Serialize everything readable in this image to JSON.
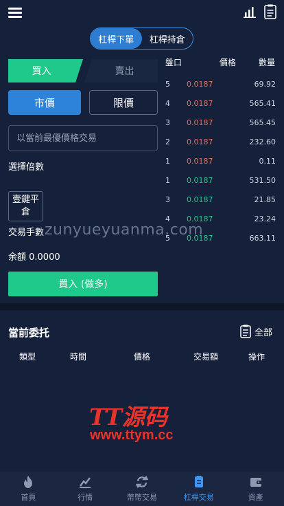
{
  "header": {
    "menu_icon": "hamburger-menu-icon",
    "chart_icon": "bar-chart-icon",
    "doc_icon": "document-list-icon"
  },
  "mode_tabs": [
    {
      "label": "杠桿下單",
      "active": true
    },
    {
      "label": "杠桿持倉",
      "active": false
    }
  ],
  "trade_tabs": {
    "buy": "買入",
    "sell": "賣出"
  },
  "order_type": {
    "market": "市價",
    "limit": "限價"
  },
  "price_input": {
    "placeholder": "以當前最優價格交易",
    "value": ""
  },
  "leverage_label": "選擇倍數",
  "one_click_close": "壹鍵平倉",
  "fee_label": "交易手數",
  "balance_label": "余額 0.0000",
  "submit_label": "買入 (做多)",
  "orderbook": {
    "headers": {
      "level": "盤口",
      "price": "價格",
      "qty": "數量"
    },
    "asks": [
      {
        "idx": "5",
        "price": "0.0187",
        "qty": "69.92"
      },
      {
        "idx": "4",
        "price": "0.0187",
        "qty": "565.41"
      },
      {
        "idx": "3",
        "price": "0.0187",
        "qty": "565.45"
      },
      {
        "idx": "2",
        "price": "0.0187",
        "qty": "232.60"
      },
      {
        "idx": "1",
        "price": "0.0187",
        "qty": "0.11"
      }
    ],
    "bids": [
      {
        "idx": "1",
        "price": "0.0187",
        "qty": "531.50"
      },
      {
        "idx": "3",
        "price": "0.0187",
        "qty": "21.85"
      },
      {
        "idx": "4",
        "price": "0.0187",
        "qty": "23.24"
      },
      {
        "idx": "5",
        "price": "0.0187",
        "qty": "663.11"
      }
    ]
  },
  "orders": {
    "title": "當前委托",
    "all_label": "全部",
    "columns": [
      "類型",
      "時間",
      "價格",
      "交易額",
      "操作"
    ]
  },
  "watermarks": {
    "w1": "zunyueyuanma.com",
    "w2": "TT源码",
    "w3": "www.ttym.cc"
  },
  "nav": [
    {
      "label": "首頁",
      "icon": "flame-icon",
      "active": false
    },
    {
      "label": "行情",
      "icon": "trend-icon",
      "active": false
    },
    {
      "label": "幣幣交易",
      "icon": "exchange-icon",
      "active": false
    },
    {
      "label": "杠桿交易",
      "icon": "leverage-doc-icon",
      "active": true
    },
    {
      "label": "資產",
      "icon": "wallet-icon",
      "active": false
    }
  ],
  "colors": {
    "accent": "#2d83d9",
    "buy": "#1fc98a",
    "ask": "#e76e5e",
    "bid": "#22c88a",
    "bg": "#15203a"
  }
}
